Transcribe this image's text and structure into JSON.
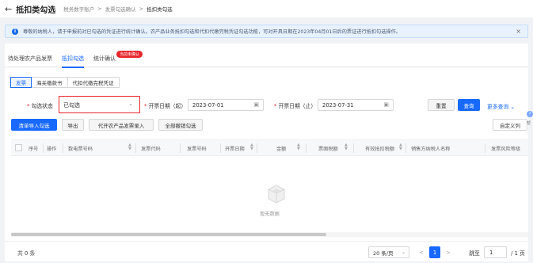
{
  "header": {
    "title": "抵扣类勾选",
    "breadcrumb": [
      "税务数字账户",
      ">",
      "发票勾选确认",
      ">",
      "抵扣类勾选"
    ]
  },
  "notice": {
    "text": "尊敬的纳税人，请于申报前对已勾选的凭证进行统计确认。农产品业务抵扣勾选和代扣代缴完税凭证勾选功能，可对开具日期在2023年04月01日后的票证进行抵扣勾选操作。",
    "close": "×"
  },
  "tabs": [
    {
      "label": "待处理农产品发票"
    },
    {
      "label": "抵扣勾选"
    },
    {
      "label": "统计确认",
      "badge": "当前未确认"
    }
  ],
  "subtabs": [
    "发票",
    "海关缴款书",
    "代扣代缴完税凭证"
  ],
  "filters": {
    "status_label": "勾选状态",
    "status_value": "已勾选",
    "date_from_label": "开票日期（起）",
    "date_from": "2023-07-01",
    "date_to_label": "开票日期（止）",
    "date_to": "2023-07-31",
    "reset": "重置",
    "search": "查询",
    "more": "更多查询"
  },
  "actions": [
    "清单导入勾选",
    "导出",
    "代开农产品发票录入",
    "全部撤销勾选"
  ],
  "custom_columns": "自定义列",
  "table": {
    "columns": [
      "序号",
      "操作",
      "数电票号码",
      "发票代码",
      "发票号码",
      "开票日期",
      "金额",
      "票面税额",
      "有效抵扣税额",
      "销售方纳税人名称",
      "发票风险等级"
    ],
    "empty_text": "暂无数据"
  },
  "footer": {
    "total": "共 0 条",
    "page_size": "20 条/页",
    "prev": "<",
    "current_page": "1",
    "next": ">",
    "jump_label": "跳至",
    "jump_value": "1",
    "page_total": "/ 1 页"
  },
  "side_panel": {
    "text": "帮"
  },
  "colors": {
    "accent": "#1769ff",
    "danger": "#e9252b"
  }
}
